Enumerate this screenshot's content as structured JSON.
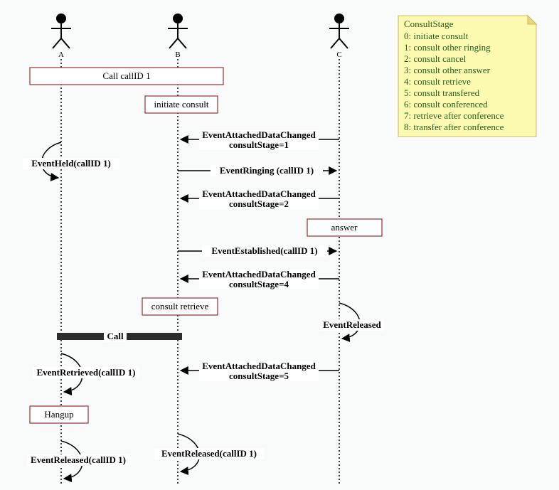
{
  "actors": {
    "a": "A",
    "b": "B",
    "c": "C"
  },
  "boxes": {
    "call": "Call callID 1",
    "initiate": "initiate consult",
    "answer": "answer",
    "retrieve": "consult retrieve",
    "hangup": "Hangup"
  },
  "events": {
    "held": "EventHeld(callID 1)",
    "ringing": "EventRinging (callID 1)",
    "established": "EventEstablished(callID 1)",
    "retrieved": "EventRetrieved(callID 1)",
    "releasedC": "EventReleased",
    "releasedB": "EventReleased(callID 1)",
    "releasedA": "EventReleased(callID 1)",
    "adc": "EventAttachedDataChanged",
    "cs1": "consultStage=1",
    "cs2": "consultStage=2",
    "cs4": "consultStage=4",
    "cs5": "consultStage=5"
  },
  "callbar": "Call",
  "note": {
    "title": "ConsultStage",
    "lines": [
      "0: initiate consult",
      "1: consult other ringing",
      "2: consult cancel",
      "3: consult other answer",
      "4: consult retrieve",
      "5: consult transfered",
      "6: consult conferenced",
      "7: retrieve after conference",
      "8: transfer after conference"
    ]
  },
  "chart_data": {
    "type": "sequence-diagram",
    "actors": [
      "A",
      "B",
      "C"
    ],
    "interactions": [
      {
        "kind": "box",
        "over": [
          "A",
          "B"
        ],
        "label": "Call callID 1"
      },
      {
        "kind": "box",
        "over": [
          "B"
        ],
        "label": "initiate consult"
      },
      {
        "kind": "message",
        "from": "C",
        "to": "B",
        "label": "EventAttachedDataChanged consultStage=1"
      },
      {
        "kind": "self",
        "at": "A",
        "label": "EventHeld(callID 1)"
      },
      {
        "kind": "message",
        "from": "B",
        "to": "C",
        "label": "EventRinging (callID 1)"
      },
      {
        "kind": "message",
        "from": "C",
        "to": "B",
        "label": "EventAttachedDataChanged consultStage=2"
      },
      {
        "kind": "box",
        "over": [
          "C"
        ],
        "label": "answer"
      },
      {
        "kind": "message",
        "from": "B",
        "to": "C",
        "label": "EventEstablished(callID 1)"
      },
      {
        "kind": "message",
        "from": "C",
        "to": "B",
        "label": "EventAttachedDataChanged consultStage=4"
      },
      {
        "kind": "box",
        "over": [
          "B"
        ],
        "label": "consult retrieve"
      },
      {
        "kind": "self",
        "at": "C",
        "label": "EventReleased"
      },
      {
        "kind": "bar",
        "over": [
          "A",
          "B"
        ],
        "label": "Call"
      },
      {
        "kind": "message",
        "from": "C",
        "to": "B",
        "label": "EventAttachedDataChanged consultStage=5"
      },
      {
        "kind": "self",
        "at": "A",
        "label": "EventRetrieved(callID 1)"
      },
      {
        "kind": "box",
        "over": [
          "A"
        ],
        "label": "Hangup"
      },
      {
        "kind": "self",
        "at": "B",
        "label": "EventReleased(callID 1)"
      },
      {
        "kind": "self",
        "at": "A",
        "label": "EventReleased(callID 1)"
      }
    ],
    "note": {
      "title": "ConsultStage",
      "items": [
        {
          "code": 0,
          "desc": "initiate consult"
        },
        {
          "code": 1,
          "desc": "consult other ringing"
        },
        {
          "code": 2,
          "desc": "consult cancel"
        },
        {
          "code": 3,
          "desc": "consult other answer"
        },
        {
          "code": 4,
          "desc": "consult retrieve"
        },
        {
          "code": 5,
          "desc": "consult transfered"
        },
        {
          "code": 6,
          "desc": "consult conferenced"
        },
        {
          "code": 7,
          "desc": "retrieve after conference"
        },
        {
          "code": 8,
          "desc": "transfer after conference"
        }
      ]
    }
  }
}
